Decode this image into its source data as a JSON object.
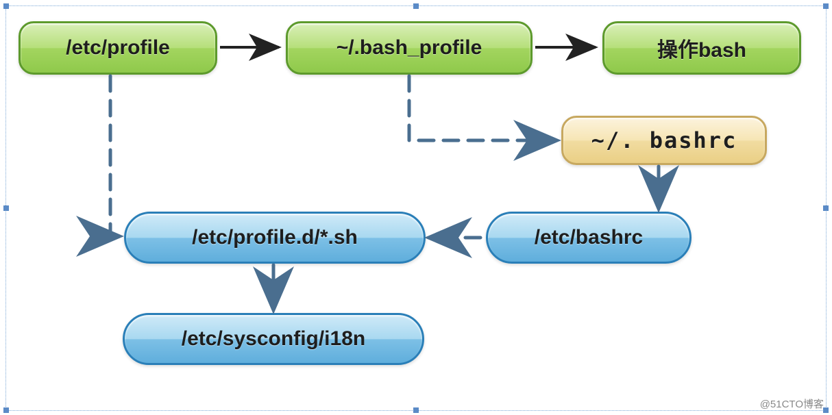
{
  "nodes": {
    "etc_profile": {
      "label": "/etc/profile"
    },
    "bash_profile": {
      "label": "~/.bash_profile"
    },
    "operate_bash": {
      "label": "操作bash"
    },
    "bashrc_home": {
      "label": "~/. bashrc"
    },
    "profile_d": {
      "label": "/etc/profile.d/*.sh"
    },
    "etc_bashrc": {
      "label": "/etc/bashrc"
    },
    "sysconfig_i18n": {
      "label": "/etc/sysconfig/i18n"
    }
  },
  "watermark": "@51CTO博客",
  "diagram_note": "Flow: /etc/profile → ~/.bash_profile → 操作bash. Dashed sources: /etc/profile ⇢ /etc/profile.d/*.sh; ~/.bash_profile ⇢ ~/.bashrc; ~/.bashrc → /etc/bashrc; /etc/bashrc ⇢ /etc/profile.d/*.sh; /etc/profile.d/*.sh → /etc/sysconfig/i18n."
}
